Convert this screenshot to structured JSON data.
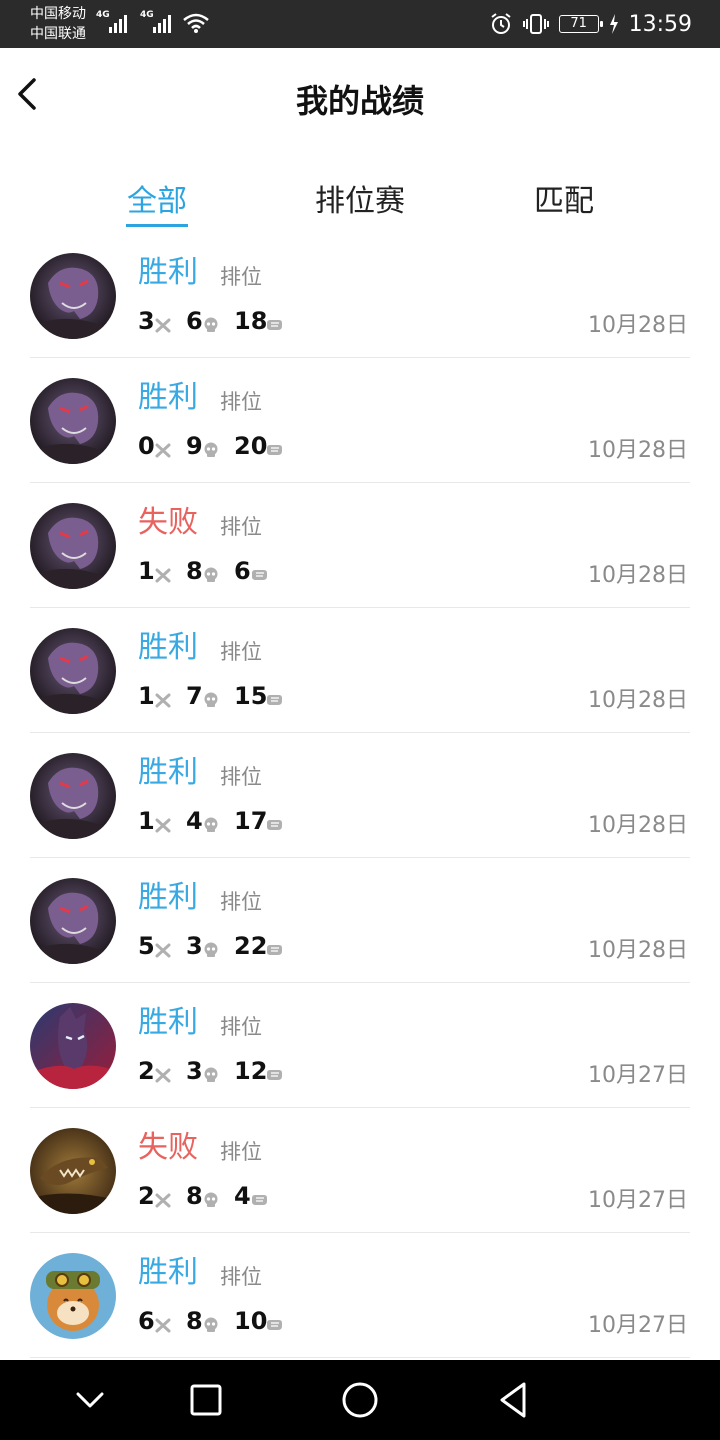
{
  "status_bar": {
    "carrier_1": "中国移动",
    "carrier_2": "中国联通",
    "net_1": "4G",
    "net_2": "4G",
    "battery": "71",
    "time": "13:59",
    "icons": [
      "signal-icon",
      "wifi-icon",
      "alarm-icon",
      "vibrate-icon",
      "battery-icon",
      "charging-icon"
    ]
  },
  "header": {
    "title": "我的战绩",
    "back_icon": "back-arrow-icon"
  },
  "tabs": [
    {
      "label": "全部",
      "active": true
    },
    {
      "label": "排位赛",
      "active": false
    },
    {
      "label": "匹配",
      "active": false
    }
  ],
  "colors": {
    "accent": "#2ba4e0",
    "win": "#39a9e3",
    "loss": "#e8625e",
    "muted": "#8a8a8a"
  },
  "matches": [
    {
      "result": "胜利",
      "outcome": "win",
      "mode": "排位",
      "kills": "3",
      "deaths": "6",
      "assists": "18",
      "date": "10月28日",
      "avatar": "dark-champion"
    },
    {
      "result": "胜利",
      "outcome": "win",
      "mode": "排位",
      "kills": "0",
      "deaths": "9",
      "assists": "20",
      "date": "10月28日",
      "avatar": "dark-champion"
    },
    {
      "result": "失败",
      "outcome": "loss",
      "mode": "排位",
      "kills": "1",
      "deaths": "8",
      "assists": "6",
      "date": "10月28日",
      "avatar": "dark-champion"
    },
    {
      "result": "胜利",
      "outcome": "win",
      "mode": "排位",
      "kills": "1",
      "deaths": "7",
      "assists": "15",
      "date": "10月28日",
      "avatar": "dark-champion"
    },
    {
      "result": "胜利",
      "outcome": "win",
      "mode": "排位",
      "kills": "1",
      "deaths": "4",
      "assists": "17",
      "date": "10月28日",
      "avatar": "dark-champion"
    },
    {
      "result": "胜利",
      "outcome": "win",
      "mode": "排位",
      "kills": "5",
      "deaths": "3",
      "assists": "22",
      "date": "10月28日",
      "avatar": "dark-champion"
    },
    {
      "result": "胜利",
      "outcome": "win",
      "mode": "排位",
      "kills": "2",
      "deaths": "3",
      "assists": "12",
      "date": "10月27日",
      "avatar": "crimson-champion"
    },
    {
      "result": "失败",
      "outcome": "loss",
      "mode": "排位",
      "kills": "2",
      "deaths": "8",
      "assists": "4",
      "date": "10月27日",
      "avatar": "crocodile-champion"
    },
    {
      "result": "胜利",
      "outcome": "win",
      "mode": "排位",
      "kills": "6",
      "deaths": "8",
      "assists": "10",
      "date": "10月27日",
      "avatar": "yordle-champion"
    }
  ],
  "nav_bar": {
    "icons": [
      "nav-hide-icon",
      "recents-icon",
      "home-icon",
      "back-triangle-icon"
    ]
  }
}
